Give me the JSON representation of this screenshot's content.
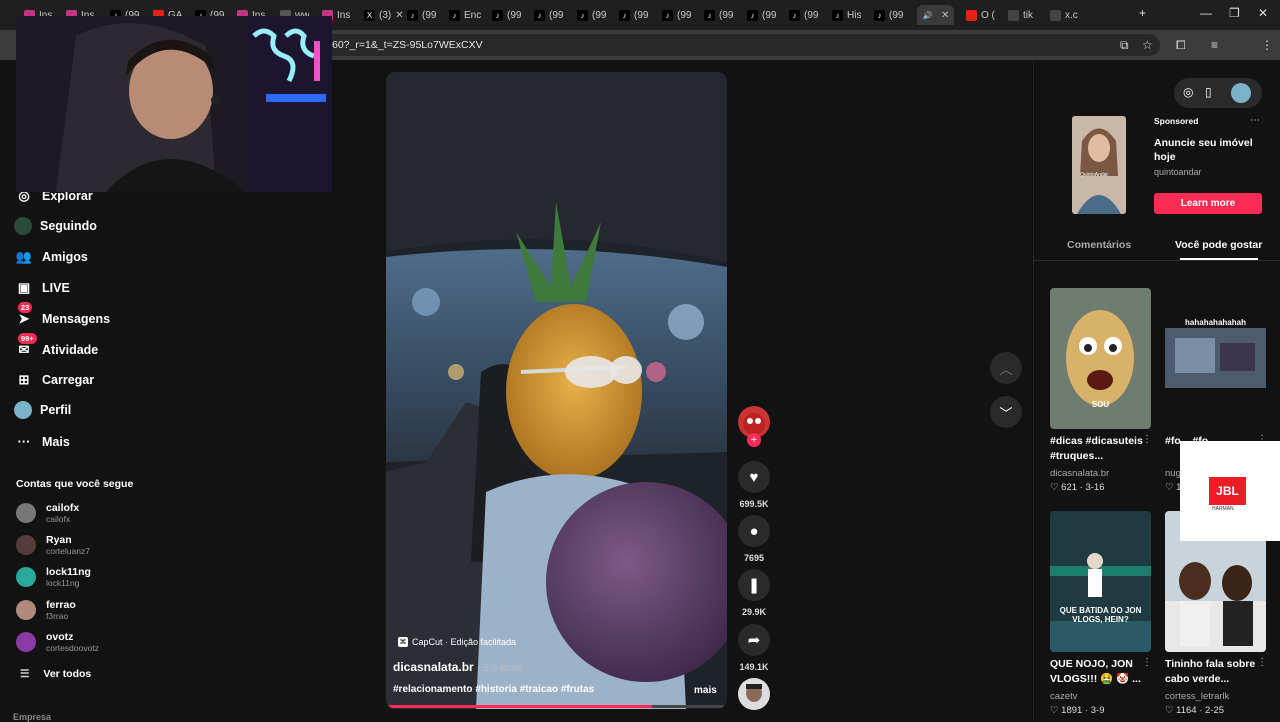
{
  "browser": {
    "tabs": [
      {
        "label": "Ins",
        "favicon": "instagram-icon",
        "color": "#c13584"
      },
      {
        "label": "Ins",
        "favicon": "instagram-icon",
        "color": "#c13584"
      },
      {
        "label": "(99",
        "favicon": "tiktok-icon",
        "color": "#000000"
      },
      {
        "label": "GA",
        "favicon": "youtube-icon",
        "color": "#e62117"
      },
      {
        "label": "(99",
        "favicon": "tiktok-icon",
        "color": "#000000"
      },
      {
        "label": "Ins",
        "favicon": "instagram-icon",
        "color": "#c13584"
      },
      {
        "label": "ww",
        "favicon": "globe-icon",
        "color": "#555555"
      },
      {
        "label": "Ins",
        "favicon": "instagram-icon",
        "color": "#c13584"
      },
      {
        "label": "(3)",
        "favicon": "x-icon",
        "color": "#000000"
      },
      {
        "label": "(99",
        "favicon": "tiktok-icon",
        "color": "#000000"
      },
      {
        "label": "Enc",
        "favicon": "tiktok-icon",
        "color": "#000000"
      },
      {
        "label": "(99",
        "favicon": "tiktok-icon",
        "color": "#000000"
      },
      {
        "label": "(99",
        "favicon": "tiktok-icon",
        "color": "#000000"
      },
      {
        "label": "(99",
        "favicon": "tiktok-icon",
        "color": "#000000"
      },
      {
        "label": "(99",
        "favicon": "tiktok-icon",
        "color": "#000000"
      },
      {
        "label": "(99",
        "favicon": "tiktok-icon",
        "color": "#000000"
      },
      {
        "label": "(99",
        "favicon": "tiktok-icon",
        "color": "#000000"
      },
      {
        "label": "(99",
        "favicon": "tiktok-icon",
        "color": "#000000"
      },
      {
        "label": "(99",
        "favicon": "tiktok-icon",
        "color": "#000000"
      },
      {
        "label": "His",
        "favicon": "tiktok-icon",
        "color": "#000000"
      },
      {
        "label": "(99",
        "favicon": "tiktok-icon",
        "color": "#000000"
      },
      {
        "label": "",
        "favicon": "speaker-icon",
        "color": "#3b3b3b"
      },
      {
        "label": "O (",
        "favicon": "youtube-icon",
        "color": "#e62117"
      },
      {
        "label": "tik",
        "favicon": "google-icon",
        "color": "#444444"
      },
      {
        "label": "x.c",
        "favicon": "globe-icon",
        "color": "#444444"
      }
    ],
    "url": "60?_r=1&_t=ZS-95Lo7WExCXV"
  },
  "sidebar": {
    "nav": [
      {
        "label": "Explorar",
        "icon": "compass-icon"
      },
      {
        "label": "Seguindo",
        "icon": "following-avatar-icon"
      },
      {
        "label": "Amigos",
        "icon": "friends-icon"
      },
      {
        "label": "LIVE",
        "icon": "live-icon"
      },
      {
        "label": "Mensagens",
        "icon": "messages-icon",
        "badge": "23"
      },
      {
        "label": "Atividade",
        "icon": "activity-icon",
        "badge": "99+"
      },
      {
        "label": "Carregar",
        "icon": "upload-icon"
      },
      {
        "label": "Perfil",
        "icon": "profile-avatar-icon"
      },
      {
        "label": "Mais",
        "icon": "more-icon"
      }
    ],
    "following_title": "Contas que você segue",
    "accounts": [
      {
        "name": "cailofx",
        "handle": "cailofx",
        "color": "#777777"
      },
      {
        "name": "Ryan",
        "handle": "corteluanz7",
        "color": "#553b3b"
      },
      {
        "name": "lock11ng",
        "handle": "lock11ng",
        "color": "#2aa89a"
      },
      {
        "name": "ferrao",
        "handle": "f3rrao",
        "color": "#b08a7a"
      },
      {
        "name": "ovotz",
        "handle": "cortesdoovotz",
        "color": "#8b3aa8"
      }
    ],
    "see_all": "Ver todos",
    "footer": "Empresa"
  },
  "video": {
    "capcut_label": "CapCut · Edição facilitada",
    "author": "dicasnalata.br",
    "time": "· 5 d atrás",
    "hashtags": "#relacionamento #historia #traicao #frutas",
    "more": "mais",
    "progress": 0.78
  },
  "actions": {
    "likes": "699.5K",
    "comments": "7695",
    "saves": "29.9K",
    "shares": "149.1K"
  },
  "ad": {
    "sponsored": "Sponsored",
    "title": "Anuncie seu imóvel hoje",
    "brand": "quintoandar",
    "cta": "Learn more",
    "thumb_caption": "QuintoAndar"
  },
  "tabs_right": {
    "comments": "Comentários",
    "you_may_like": "Você pode gostar"
  },
  "suggestions": [
    {
      "title": "#dicas #dicasuteis #truques...",
      "author": "dicasnalata.br",
      "likes": "621",
      "date": "3-16",
      "thumb_text": "SOU"
    },
    {
      "title": "#fo... #fo...",
      "author": "nug...",
      "likes": "1...",
      "date": "",
      "thumb_text": "hahahahahahah"
    },
    {
      "title": "QUE NOJO, JON VLOGS!!! 🤮 🤡 ...",
      "author": "cazetv",
      "likes": "1891",
      "date": "3-9",
      "thumb_text": "QUE BATIDA DO JON VLOGS, HEIN?"
    },
    {
      "title": "Tininho fala sobre cabo verde...",
      "author": "cortess_letrarlk",
      "likes": "1164",
      "date": "2-25",
      "thumb_text": ""
    }
  ],
  "overlay_logo": {
    "text": "JBL",
    "subtext": "HARMAN",
    "color": "#ee1c25"
  }
}
